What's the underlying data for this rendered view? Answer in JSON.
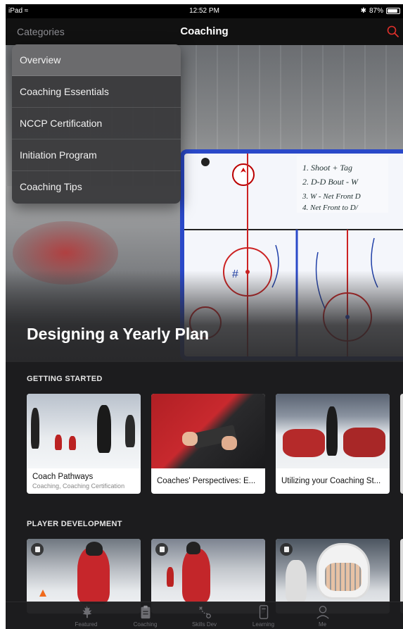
{
  "status_bar": {
    "device": "iPad",
    "time": "12:52 PM",
    "battery": "87%",
    "battery_level": 0.87
  },
  "nav": {
    "left": "Categories",
    "title": "Coaching",
    "search_icon": "search-icon",
    "accent": "#e0302b"
  },
  "categories_menu": [
    {
      "label": "Overview",
      "active": true
    },
    {
      "label": "Coaching Essentials",
      "active": false
    },
    {
      "label": "NCCP Certification",
      "active": false
    },
    {
      "label": "Initiation Program",
      "active": false
    },
    {
      "label": "Coaching Tips",
      "active": false
    }
  ],
  "hero": {
    "title": "Designing a Yearly Plan",
    "board_notes": [
      "1. Shoot + Tag",
      "2. D-D Bout - W",
      "3. W - Net Front D",
      "4. Net Front to D/"
    ]
  },
  "sections": [
    {
      "label": "GETTING STARTED",
      "cards": [
        {
          "title": "Coach Pathways",
          "subtitle": "Coaching, Coaching Certification"
        },
        {
          "title": "Coaches' Perspectives: E...",
          "subtitle": ""
        },
        {
          "title": "Utilizing your Coaching St...",
          "subtitle": ""
        }
      ]
    },
    {
      "label": "PLAYER DEVELOPMENT",
      "cards": [
        {
          "title": "",
          "subtitle": ""
        },
        {
          "title": "",
          "subtitle": ""
        },
        {
          "title": "",
          "subtitle": ""
        }
      ]
    }
  ],
  "tabs": [
    {
      "label": "Featured",
      "icon": "maple-leaf-icon"
    },
    {
      "label": "Coaching",
      "icon": "clipboard-icon"
    },
    {
      "label": "Skills Dev",
      "icon": "play-diagram-icon"
    },
    {
      "label": "Learning",
      "icon": "document-icon"
    },
    {
      "label": "Me",
      "icon": "person-icon"
    }
  ]
}
